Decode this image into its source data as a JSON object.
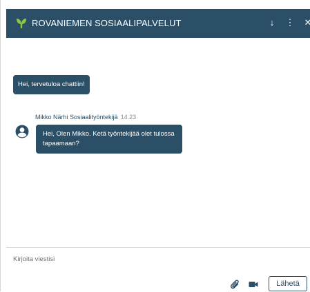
{
  "header": {
    "title": "ROVANIEMEN SOSIAALIPALVELUT",
    "logo_icon": "heart-leaf-logo",
    "download_icon": "↓",
    "more_icon": "⋮",
    "close_icon": "✕"
  },
  "messages": {
    "welcome": "Hei, tervetuloa chattiin!",
    "agent": {
      "sender": "Mikko Närhi Sosiaalityöntekijä",
      "time": "14.23",
      "text": "Hei, Olen Mikko. Ketä työntekijää olet tulossa tapaamaan?"
    }
  },
  "composer": {
    "placeholder": "Kirjoita viestisi",
    "value": "",
    "send_label": "Lähetä",
    "attach_icon": "paperclip-icon",
    "video_icon": "video-camera-icon"
  },
  "colors": {
    "primary": "#2b4f66",
    "logo_green": "#8dc63f"
  }
}
